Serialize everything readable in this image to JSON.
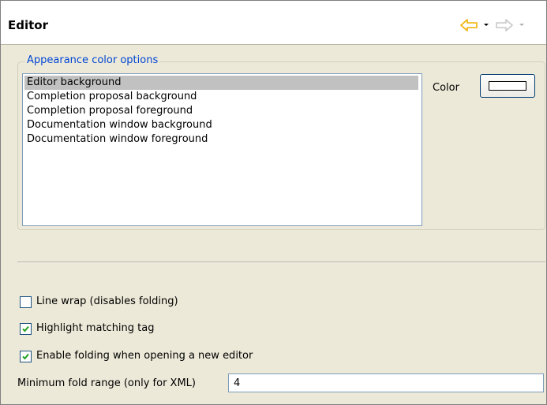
{
  "header": {
    "title": "Editor"
  },
  "nav": {
    "back_icon": "back-arrow-icon",
    "forward_icon": "forward-arrow-icon",
    "colors": {
      "active": "#f0b000",
      "inactive": "#c8c8c8"
    }
  },
  "appearance": {
    "legend": "Appearance color options",
    "items": [
      {
        "label": "Editor background",
        "selected": true
      },
      {
        "label": "Completion proposal background",
        "selected": false
      },
      {
        "label": "Completion proposal foreground",
        "selected": false
      },
      {
        "label": "Documentation window background",
        "selected": false
      },
      {
        "label": "Documentation window foreground",
        "selected": false
      }
    ],
    "color_label": "Color",
    "color_value": "#ffffff"
  },
  "options": {
    "line_wrap": {
      "label": "Line wrap (disables folding)",
      "checked": false
    },
    "highlight_tag": {
      "label": "Highlight matching tag",
      "checked": true
    },
    "enable_folding": {
      "label": "Enable folding when opening a new editor",
      "checked": true
    }
  },
  "fold_range": {
    "label": "Minimum fold range (only for XML)",
    "value": "4"
  }
}
